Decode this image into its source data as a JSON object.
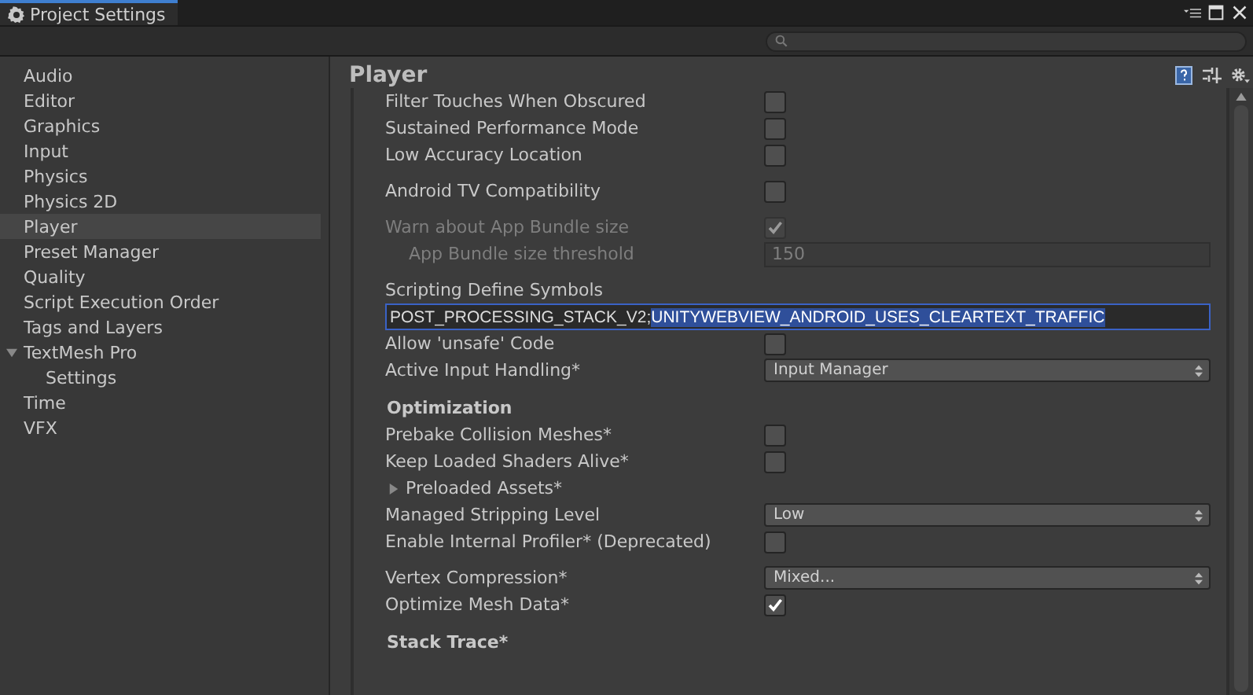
{
  "window": {
    "title": "Project Settings"
  },
  "sidebar": {
    "items": [
      {
        "label": "Audio",
        "selected": false
      },
      {
        "label": "Editor",
        "selected": false
      },
      {
        "label": "Graphics",
        "selected": false
      },
      {
        "label": "Input",
        "selected": false
      },
      {
        "label": "Physics",
        "selected": false
      },
      {
        "label": "Physics 2D",
        "selected": false
      },
      {
        "label": "Player",
        "selected": true
      },
      {
        "label": "Preset Manager",
        "selected": false
      },
      {
        "label": "Quality",
        "selected": false
      },
      {
        "label": "Script Execution Order",
        "selected": false
      },
      {
        "label": "Tags and Layers",
        "selected": false
      },
      {
        "label": "TextMesh Pro",
        "selected": false,
        "expanded": true,
        "children": [
          {
            "label": "Settings",
            "selected": false
          }
        ]
      },
      {
        "label": "Time",
        "selected": false
      },
      {
        "label": "VFX",
        "selected": false
      }
    ]
  },
  "panel": {
    "title": "Player",
    "sections": [
      {
        "groups": [
          [
            {
              "kind": "checkbox",
              "label": "Filter Touches When Obscured",
              "checked": false,
              "disabled": false
            },
            {
              "kind": "checkbox",
              "label": "Sustained Performance Mode",
              "checked": false,
              "disabled": false
            },
            {
              "kind": "checkbox",
              "label": "Low Accuracy Location",
              "checked": false,
              "disabled": false
            }
          ],
          [
            {
              "kind": "checkbox",
              "label": "Android TV Compatibility",
              "checked": false,
              "disabled": false
            }
          ],
          [
            {
              "kind": "checkbox",
              "label": "Warn about App Bundle size",
              "checked": true,
              "disabled": true
            },
            {
              "kind": "number",
              "label": "App Bundle size threshold",
              "value": "150",
              "disabled": true
            }
          ],
          [
            {
              "kind": "label",
              "label": "Scripting Define Symbols"
            },
            {
              "kind": "text",
              "value": "POST_PROCESSING_STACK_V2;",
              "selected_value": "UNITYWEBVIEW_ANDROID_USES_CLEARTEXT_TRAFFIC"
            },
            {
              "kind": "checkbox",
              "label": "Allow 'unsafe' Code",
              "checked": false,
              "disabled": false
            },
            {
              "kind": "dropdown",
              "label": "Active Input Handling*",
              "value": "Input Manager"
            }
          ]
        ]
      },
      {
        "header": "Optimization",
        "groups": [
          [
            {
              "kind": "checkbox",
              "label": "Prebake Collision Meshes*",
              "checked": false,
              "disabled": false
            },
            {
              "kind": "checkbox",
              "label": "Keep Loaded Shaders Alive*",
              "checked": false,
              "disabled": false
            },
            {
              "kind": "foldout",
              "label": "Preloaded Assets*",
              "expanded": false
            },
            {
              "kind": "dropdown",
              "label": "Managed Stripping Level",
              "value": "Low"
            },
            {
              "kind": "checkbox",
              "label": "Enable Internal Profiler* (Deprecated)",
              "checked": false,
              "disabled": false
            }
          ],
          [
            {
              "kind": "dropdown",
              "label": "Vertex Compression*",
              "value": "Mixed..."
            },
            {
              "kind": "checkbox",
              "label": "Optimize Mesh Data*",
              "checked": true,
              "disabled": false
            }
          ]
        ]
      },
      {
        "header": "Stack Trace*"
      }
    ]
  }
}
